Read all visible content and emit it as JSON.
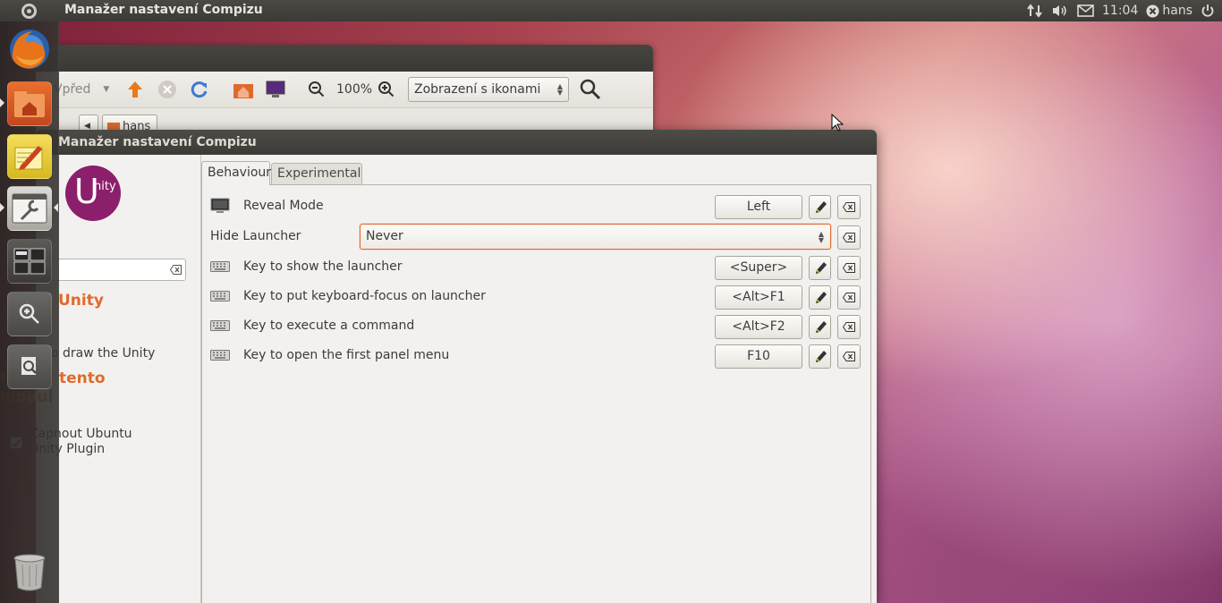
{
  "panel": {
    "app_title": "Manažer nastavení Compizu",
    "clock": "11:04",
    "user": "hans",
    "indicators": [
      "network-icon",
      "volume-icon",
      "mail-icon",
      "user-icon",
      "power-icon"
    ]
  },
  "launcher": {
    "items": [
      "firefox-icon",
      "home-folder-icon",
      "text-editor-icon",
      "ccsm-icon",
      "workspace-switcher-icon",
      "zoom-icon",
      "search-files-icon",
      "trash-icon"
    ]
  },
  "nautilus": {
    "forward_label": "Vpřed",
    "zoom_level": "100%",
    "view_mode": "Zobrazení s ikonami",
    "crumb_label": "hans"
  },
  "ccsm": {
    "title": "Manažer nastavení Compizu",
    "logo_u": "U",
    "logo_nity": "nity",
    "plugin_name": "Unity",
    "plugin_desc": "o draw the Unity",
    "use_module": "Použít tento modul",
    "enable_label": "Zapnout Ubuntu Unity Plugin",
    "enable_checked": true,
    "tabs": [
      {
        "label": "Behaviour",
        "active": true
      },
      {
        "label": "Experimental",
        "active": false
      }
    ],
    "rows": [
      {
        "label": "Reveal Mode",
        "value": "Left",
        "icon": "monitor-icon"
      },
      {
        "label": "Hide Launcher",
        "value": "Never",
        "type": "select"
      },
      {
        "label": "Key to show the launcher",
        "value": "<Super>",
        "icon": "keyboard-icon"
      },
      {
        "label": "Key to put keyboard-focus on launcher",
        "value": "<Alt>F1",
        "icon": "keyboard-icon"
      },
      {
        "label": "Key to execute a command",
        "value": "<Alt>F2",
        "icon": "keyboard-icon"
      },
      {
        "label": "Key to open the first panel menu",
        "value": "F10",
        "icon": "keyboard-icon"
      }
    ]
  },
  "colors": {
    "accent": "#e06a2c",
    "ubuntu_purple": "#8c1f6c",
    "panel": "#3c3b37"
  }
}
